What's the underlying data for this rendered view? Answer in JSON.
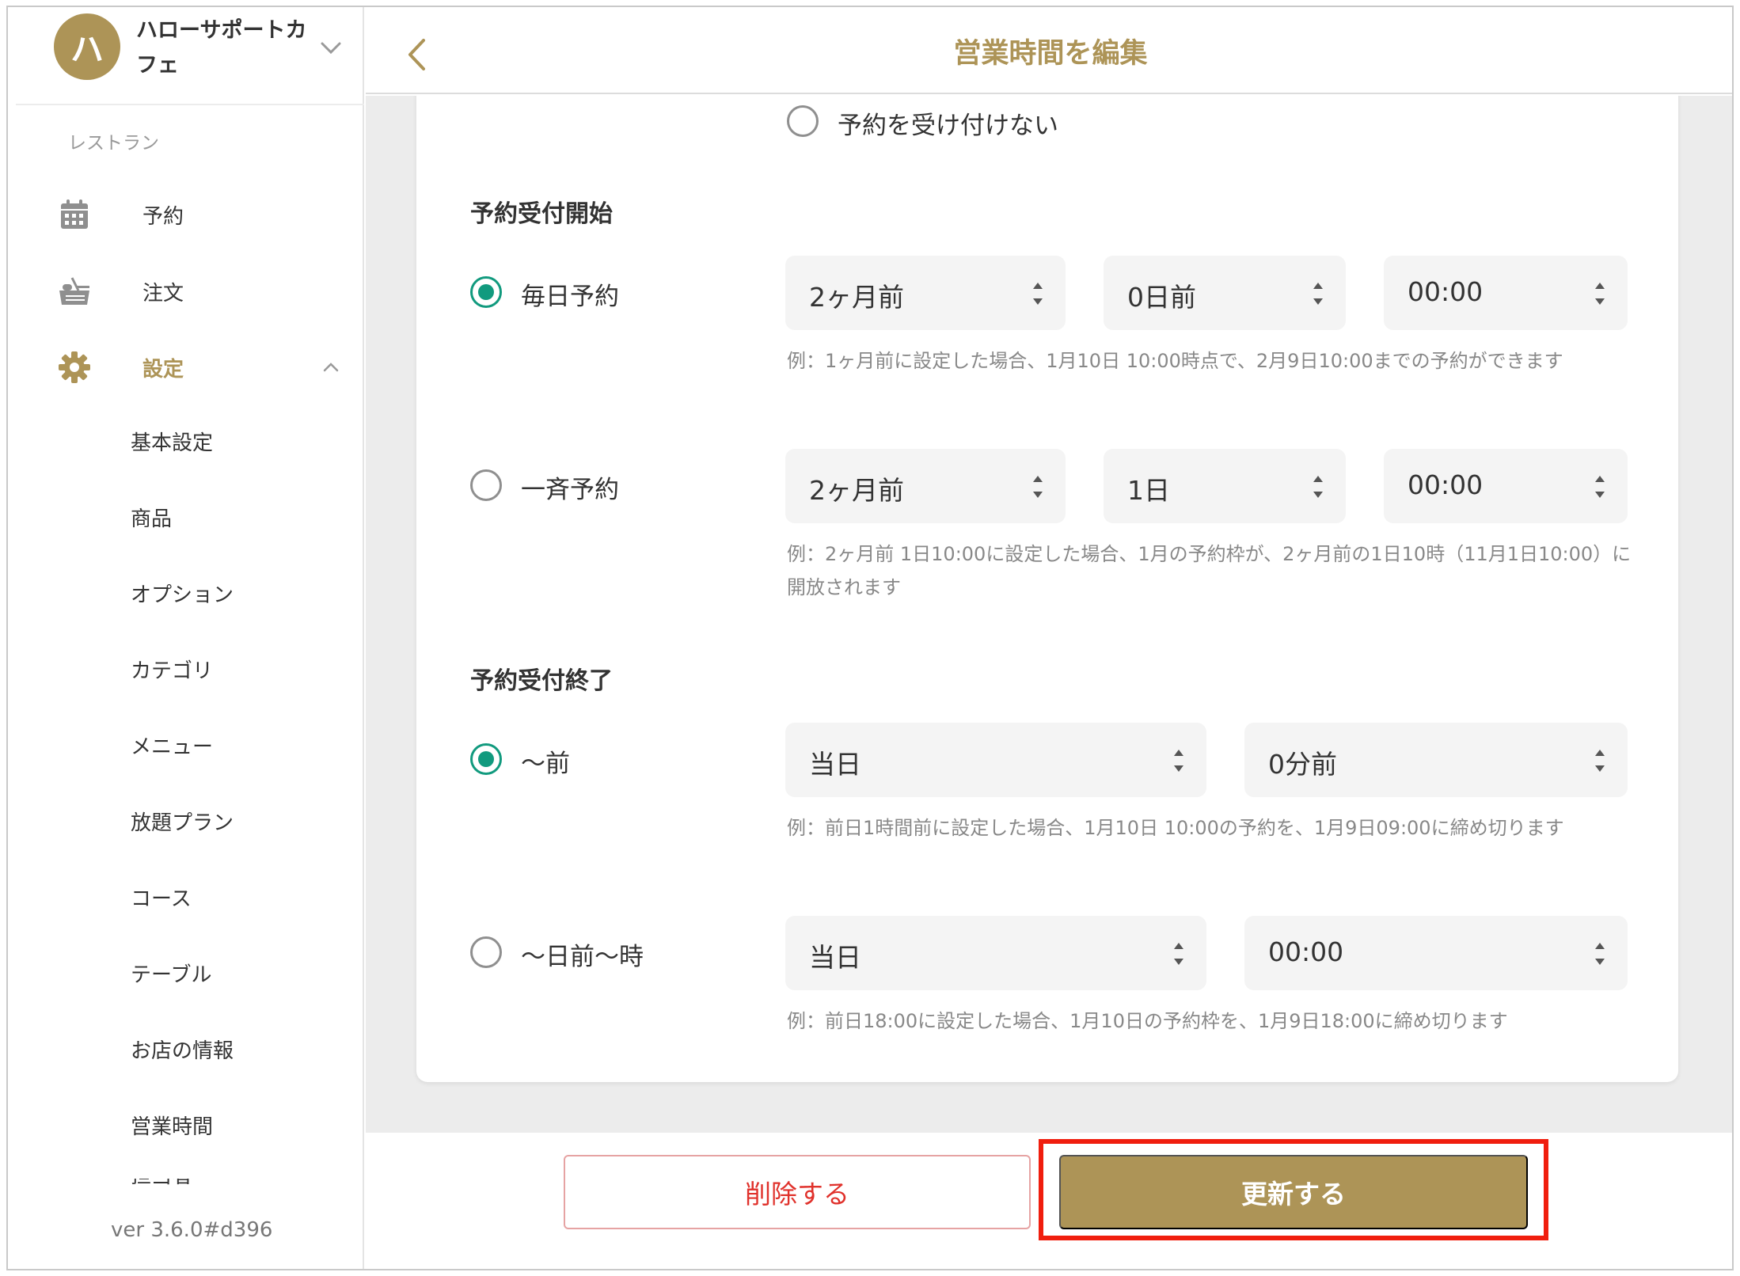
{
  "sidebar": {
    "store": {
      "avatar": "ハ",
      "name": "ハローサポートカフェ"
    },
    "section_label": "レストラン",
    "nav": [
      {
        "label": "予約",
        "icon": "calendar-icon"
      },
      {
        "label": "注文",
        "icon": "food-icon"
      },
      {
        "label": "設定",
        "icon": "gear-icon"
      }
    ],
    "settings_items": [
      "基本設定",
      "商品",
      "オプション",
      "カテゴリ",
      "メニュー",
      "放題プラン",
      "コース",
      "テーブル",
      "お店の情報",
      "営業時間"
    ],
    "cut_item": "担当者",
    "version": "ver 3.6.0#d396"
  },
  "header": {
    "title": "営業時間を編集"
  },
  "form": {
    "no_reservation_label": "予約を受け付けない",
    "start": {
      "heading": "予約受付開始",
      "daily": {
        "label": "毎日予約",
        "selected": true,
        "values": [
          "2ヶ月前",
          "0日前",
          "00:00"
        ],
        "note": "例：1ヶ月前に設定した場合、1月10日 10:00時点で、2月9日10:00までの予約ができます"
      },
      "batch": {
        "label": "一斉予約",
        "selected": false,
        "values": [
          "2ヶ月前",
          "1日",
          "00:00"
        ],
        "note": "例：2ヶ月前 1日10:00に設定した場合、1月の予約枠が、2ヶ月前の1日10時（11月1日10:00）に開放されます"
      }
    },
    "end": {
      "heading": "予約受付終了",
      "before": {
        "label": "〜前",
        "selected": true,
        "values": [
          "当日",
          "0分前"
        ],
        "note": "例：前日1時間前に設定した場合、1月10日 10:00の予約を、1月9日09:00に締め切ります"
      },
      "days_time": {
        "label": "〜日前〜時",
        "selected": false,
        "values": [
          "当日",
          "00:00"
        ],
        "note": "例：前日18:00に設定した場合、1月10日の予約枠を、1月9日18:00に締め切ります"
      }
    }
  },
  "footer": {
    "delete_label": "削除する",
    "update_label": "更新する"
  },
  "colors": {
    "accent": "#ad9457",
    "radio": "#119a7e",
    "danger": "#e0312b",
    "highlight": "#f01e0e"
  }
}
